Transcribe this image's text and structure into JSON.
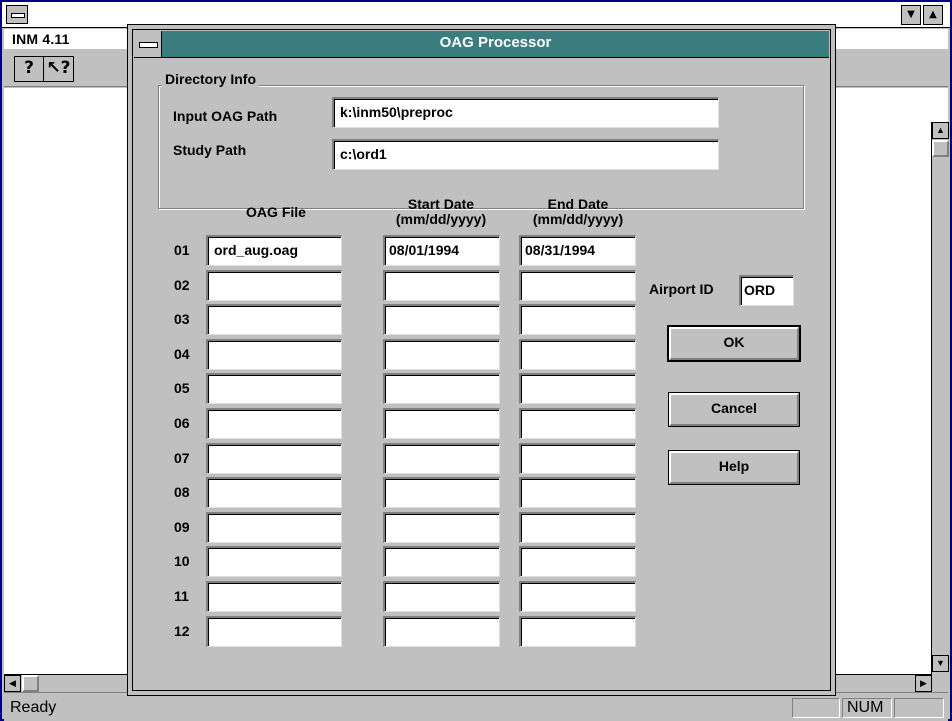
{
  "app": {
    "title_buttons": {
      "minimize": "▼",
      "maximize": "▲"
    },
    "menu_title": "INM 4.11",
    "toolbar": {
      "help_icon": "?",
      "context_help_icon": "↖?"
    },
    "status": {
      "text": "Ready",
      "num": "NUM"
    }
  },
  "dialog": {
    "title": "OAG Processor",
    "directory_group": "Directory Info",
    "input_path_label": "Input OAG Path",
    "input_path_value": "k:\\inm50\\preproc",
    "study_path_label": "Study Path",
    "study_path_value": "c:\\ord1",
    "columns": {
      "file": "OAG File",
      "start": "Start Date\n(mm/dd/yyyy)",
      "end": "End Date\n(mm/dd/yyyy)"
    },
    "rows": [
      {
        "num": "01",
        "file": "ord_aug.oag",
        "start": "08/01/1994",
        "end": "08/31/1994"
      },
      {
        "num": "02",
        "file": "",
        "start": "",
        "end": ""
      },
      {
        "num": "03",
        "file": "",
        "start": "",
        "end": ""
      },
      {
        "num": "04",
        "file": "",
        "start": "",
        "end": ""
      },
      {
        "num": "05",
        "file": "",
        "start": "",
        "end": ""
      },
      {
        "num": "06",
        "file": "",
        "start": "",
        "end": ""
      },
      {
        "num": "07",
        "file": "",
        "start": "",
        "end": ""
      },
      {
        "num": "08",
        "file": "",
        "start": "",
        "end": ""
      },
      {
        "num": "09",
        "file": "",
        "start": "",
        "end": ""
      },
      {
        "num": "10",
        "file": "",
        "start": "",
        "end": ""
      },
      {
        "num": "11",
        "file": "",
        "start": "",
        "end": ""
      },
      {
        "num": "12",
        "file": "",
        "start": "",
        "end": ""
      }
    ],
    "airport_label": "Airport ID",
    "airport_value": "ORD",
    "buttons": {
      "ok": "OK",
      "cancel": "Cancel",
      "help": "Help"
    }
  },
  "colors": {
    "dialog_title_bg": "#3a7e80",
    "window_bg": "#c0c0c0",
    "frame": "#000080"
  }
}
